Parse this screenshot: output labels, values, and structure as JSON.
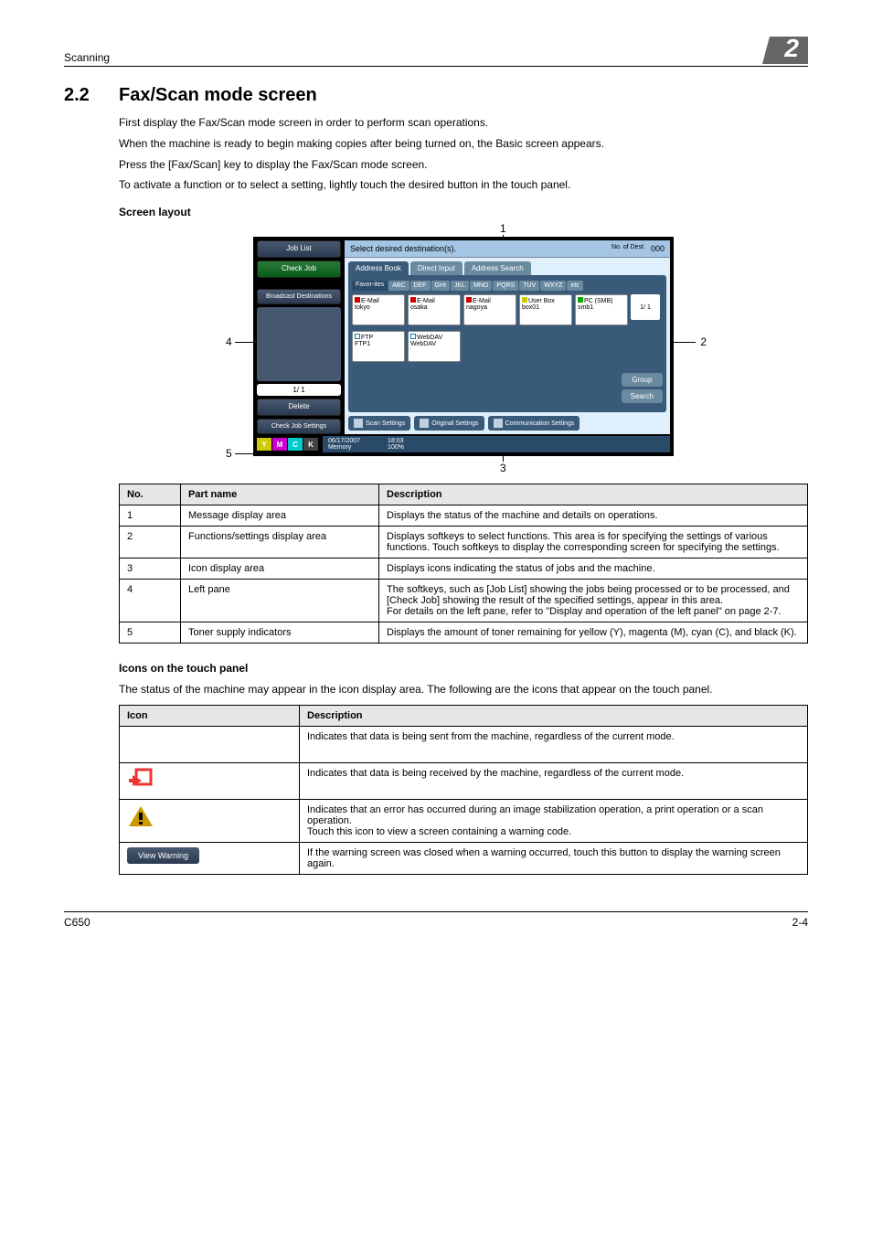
{
  "header": {
    "section": "Scanning",
    "chapter": "2"
  },
  "section": {
    "number": "2.2",
    "title": "Fax/Scan mode screen",
    "p1": "First display the Fax/Scan mode screen in order to perform scan operations.",
    "p2": "When the machine is ready to begin making copies after being turned on, the Basic screen appears.",
    "p3": "Press the [Fax/Scan] key to display the Fax/Scan mode screen.",
    "p4": "To activate a function or to select a setting, lightly touch the desired button in the touch panel."
  },
  "screen_layout_heading": "Screen layout",
  "callouts": {
    "c1": "1",
    "c2": "2",
    "c3": "3",
    "c4": "4",
    "c5": "5"
  },
  "device_screen": {
    "msg": "Select desired destination(s).",
    "dest_label": "No. of Dest.",
    "dest_count": "000",
    "left": {
      "job_list": "Job List",
      "check_job": "Check Job",
      "broadcast": "Broadcast Destinations",
      "page": "1/  1",
      "delete": "Delete",
      "check_settings": "Check Job Settings"
    },
    "tabs": {
      "address_book": "Address Book",
      "direct_input": "Direct Input",
      "address_search": "Address Search"
    },
    "index": [
      "Favor-ites",
      "ABC",
      "DEF",
      "GHI",
      "JKL",
      "MNO",
      "PQRS",
      "TUV",
      "WXYZ",
      "etc"
    ],
    "dest": [
      {
        "type": "E-Mail",
        "name": "tokyo",
        "ico": "red"
      },
      {
        "type": "E-Mail",
        "name": "osaka",
        "ico": "red"
      },
      {
        "type": "E-Mail",
        "name": "nagoya",
        "ico": "red"
      },
      {
        "type": "User Box",
        "name": "box01",
        "ico": "yellow"
      },
      {
        "type": "PC (SMB)",
        "name": "smb1",
        "ico": "green"
      },
      {
        "type": "FTP",
        "name": "FTP1",
        "ico": "outline"
      },
      {
        "type": "WebDAV",
        "name": "WebDAV",
        "ico": "outline"
      }
    ],
    "dest_page": "1/  1",
    "group": "Group",
    "search": "Search",
    "footer_tabs": {
      "scan": "Scan Settings",
      "original": "Original Settings",
      "comm": "Communication Settings"
    },
    "status": {
      "date": "06/17/2007",
      "time": "18:03",
      "memory_label": "Memory",
      "memory_value": "100%"
    },
    "toner": {
      "y": "Y",
      "m": "M",
      "c": "C",
      "k": "K"
    }
  },
  "parts_table": {
    "headers": {
      "no": "No.",
      "name": "Part name",
      "desc": "Description"
    },
    "rows": [
      {
        "no": "1",
        "name": "Message display area",
        "desc": "Displays the status of the machine and details on operations."
      },
      {
        "no": "2",
        "name": "Functions/settings display area",
        "desc": "Displays softkeys to select functions. This area is for specifying the settings of various functions. Touch softkeys to display the corresponding screen for specifying the settings."
      },
      {
        "no": "3",
        "name": "Icon display area",
        "desc": "Displays icons indicating the status of jobs and the machine."
      },
      {
        "no": "4",
        "name": "Left pane",
        "desc": "The softkeys, such as [Job List] showing the jobs being processed or to be processed, and [Check Job] showing the result of the specified settings, appear in this area.\nFor details on the left pane, refer to \"Display and operation of the left panel\" on page 2-7."
      },
      {
        "no": "5",
        "name": "Toner supply indicators",
        "desc": "Displays the amount of toner remaining for yellow (Y), magenta (M), cyan (C), and black (K)."
      }
    ]
  },
  "icons_heading": "Icons on the touch panel",
  "icons_intro": "The status of the machine may appear in the icon display area. The following are the icons that appear on the touch panel.",
  "icons_table": {
    "headers": {
      "icon": "Icon",
      "desc": "Description"
    },
    "rows": [
      {
        "icon": "data-send-icon",
        "desc": "Indicates that data is being sent from the machine, regardless of the current mode."
      },
      {
        "icon": "data-receive-icon",
        "desc": "Indicates that data is being received by the machine, regardless of the current mode."
      },
      {
        "icon": "warning-triangle-icon",
        "desc": "Indicates that an error has occurred during an image stabilization operation, a print operation or a scan operation.\nTouch this icon to view a screen containing a warning code."
      },
      {
        "icon": "view-warning-button",
        "label": "View Warning",
        "desc": "If the warning screen was closed when a warning occurred, touch this button to display the warning screen again."
      }
    ]
  },
  "footer": {
    "model": "C650",
    "page": "2-4"
  }
}
